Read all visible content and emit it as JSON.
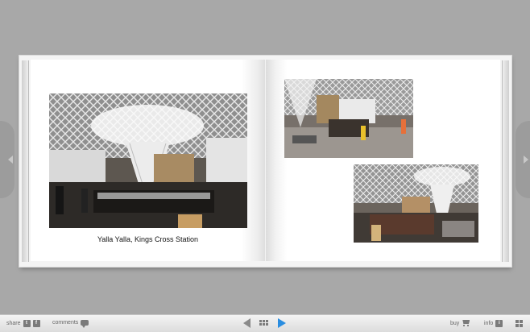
{
  "album": {
    "caption": "Yalla Yalla,  Kings Cross Station"
  },
  "photos": [
    {
      "name": "photo-yalla-yalla-main"
    },
    {
      "name": "photo-station-concourse-top"
    },
    {
      "name": "photo-station-concourse-bottom"
    }
  ],
  "toolbar": {
    "share_label": "share",
    "twitter_icon_text": "t",
    "facebook_icon_text": "f",
    "comments_label": "comments",
    "buy_label": "buy",
    "info_label": "info",
    "info_icon_text": "i"
  },
  "icons": {
    "prev": "triangle-left-icon",
    "thumbnails": "grid-icon",
    "play": "play-icon",
    "cart": "cart-icon",
    "fullscreen": "fullscreen-icon"
  },
  "colors": {
    "background": "#a8a8a8",
    "play_accent": "#2a8de0",
    "toolbar": "#e6e6e6"
  }
}
